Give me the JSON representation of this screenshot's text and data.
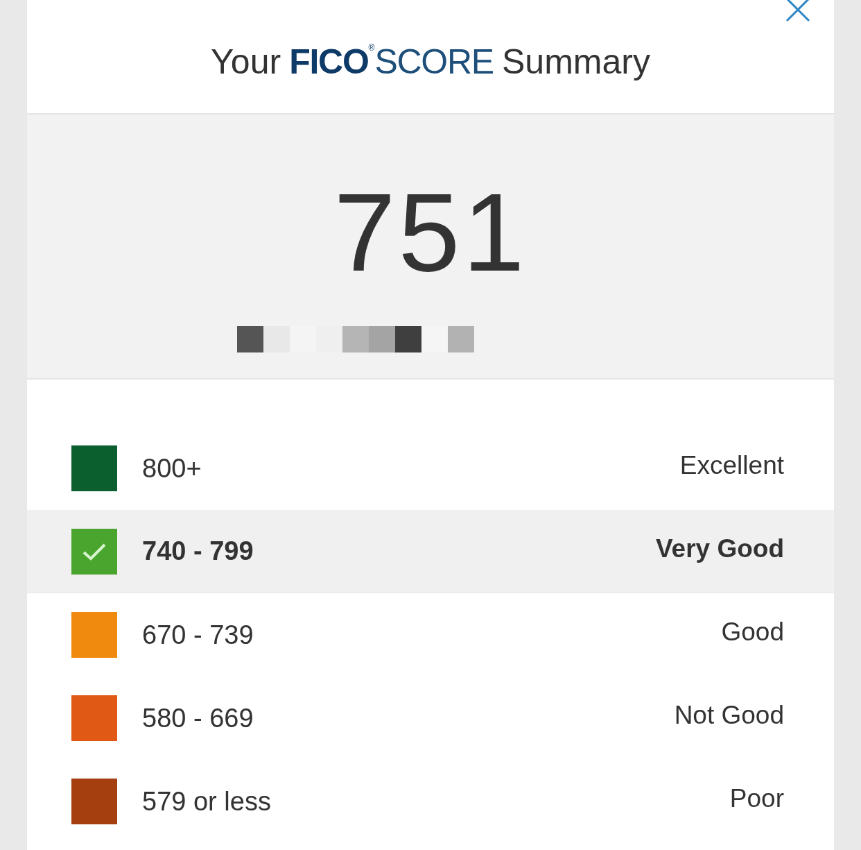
{
  "header": {
    "prefix": "Your",
    "brand": "FICO",
    "registered": "®",
    "brand_suffix": "SCORE",
    "suffix": "Summary"
  },
  "score": {
    "value": "751"
  },
  "ranges": [
    {
      "range": "800+",
      "rating": "Excellent",
      "color": "#0b5e2e",
      "selected": false
    },
    {
      "range": "740 - 799",
      "rating": "Very Good",
      "color": "#4aa52e",
      "selected": true
    },
    {
      "range": "670 - 739",
      "rating": "Good",
      "color": "#ef8a0e",
      "selected": false
    },
    {
      "range": "580 - 669",
      "rating": "Not Good",
      "color": "#e05a16",
      "selected": false
    },
    {
      "range": "579 or less",
      "rating": "Poor",
      "color": "#a63f10",
      "selected": false
    }
  ]
}
